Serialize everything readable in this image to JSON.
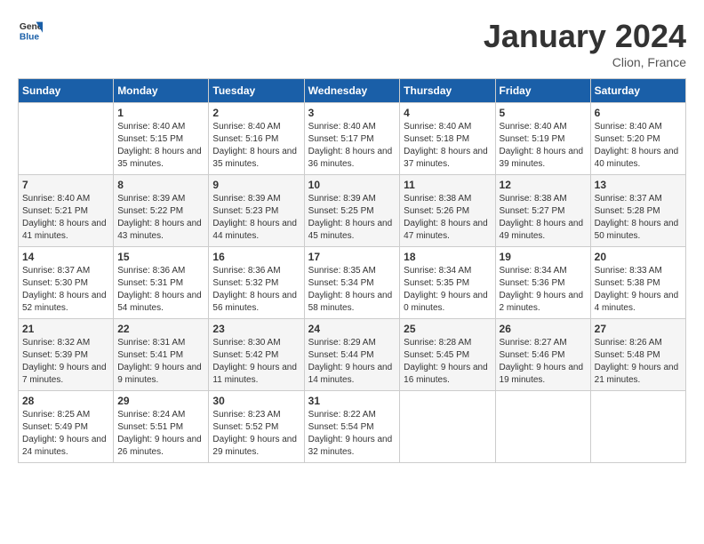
{
  "header": {
    "logo_line1": "General",
    "logo_line2": "Blue",
    "month_year": "January 2024",
    "location": "Clion, France"
  },
  "weekdays": [
    "Sunday",
    "Monday",
    "Tuesday",
    "Wednesday",
    "Thursday",
    "Friday",
    "Saturday"
  ],
  "weeks": [
    [
      {
        "day": "",
        "sunrise": "",
        "sunset": "",
        "daylight": ""
      },
      {
        "day": "1",
        "sunrise": "Sunrise: 8:40 AM",
        "sunset": "Sunset: 5:15 PM",
        "daylight": "Daylight: 8 hours and 35 minutes."
      },
      {
        "day": "2",
        "sunrise": "Sunrise: 8:40 AM",
        "sunset": "Sunset: 5:16 PM",
        "daylight": "Daylight: 8 hours and 35 minutes."
      },
      {
        "day": "3",
        "sunrise": "Sunrise: 8:40 AM",
        "sunset": "Sunset: 5:17 PM",
        "daylight": "Daylight: 8 hours and 36 minutes."
      },
      {
        "day": "4",
        "sunrise": "Sunrise: 8:40 AM",
        "sunset": "Sunset: 5:18 PM",
        "daylight": "Daylight: 8 hours and 37 minutes."
      },
      {
        "day": "5",
        "sunrise": "Sunrise: 8:40 AM",
        "sunset": "Sunset: 5:19 PM",
        "daylight": "Daylight: 8 hours and 39 minutes."
      },
      {
        "day": "6",
        "sunrise": "Sunrise: 8:40 AM",
        "sunset": "Sunset: 5:20 PM",
        "daylight": "Daylight: 8 hours and 40 minutes."
      }
    ],
    [
      {
        "day": "7",
        "sunrise": "Sunrise: 8:40 AM",
        "sunset": "Sunset: 5:21 PM",
        "daylight": "Daylight: 8 hours and 41 minutes."
      },
      {
        "day": "8",
        "sunrise": "Sunrise: 8:39 AM",
        "sunset": "Sunset: 5:22 PM",
        "daylight": "Daylight: 8 hours and 43 minutes."
      },
      {
        "day": "9",
        "sunrise": "Sunrise: 8:39 AM",
        "sunset": "Sunset: 5:23 PM",
        "daylight": "Daylight: 8 hours and 44 minutes."
      },
      {
        "day": "10",
        "sunrise": "Sunrise: 8:39 AM",
        "sunset": "Sunset: 5:25 PM",
        "daylight": "Daylight: 8 hours and 45 minutes."
      },
      {
        "day": "11",
        "sunrise": "Sunrise: 8:38 AM",
        "sunset": "Sunset: 5:26 PM",
        "daylight": "Daylight: 8 hours and 47 minutes."
      },
      {
        "day": "12",
        "sunrise": "Sunrise: 8:38 AM",
        "sunset": "Sunset: 5:27 PM",
        "daylight": "Daylight: 8 hours and 49 minutes."
      },
      {
        "day": "13",
        "sunrise": "Sunrise: 8:37 AM",
        "sunset": "Sunset: 5:28 PM",
        "daylight": "Daylight: 8 hours and 50 minutes."
      }
    ],
    [
      {
        "day": "14",
        "sunrise": "Sunrise: 8:37 AM",
        "sunset": "Sunset: 5:30 PM",
        "daylight": "Daylight: 8 hours and 52 minutes."
      },
      {
        "day": "15",
        "sunrise": "Sunrise: 8:36 AM",
        "sunset": "Sunset: 5:31 PM",
        "daylight": "Daylight: 8 hours and 54 minutes."
      },
      {
        "day": "16",
        "sunrise": "Sunrise: 8:36 AM",
        "sunset": "Sunset: 5:32 PM",
        "daylight": "Daylight: 8 hours and 56 minutes."
      },
      {
        "day": "17",
        "sunrise": "Sunrise: 8:35 AM",
        "sunset": "Sunset: 5:34 PM",
        "daylight": "Daylight: 8 hours and 58 minutes."
      },
      {
        "day": "18",
        "sunrise": "Sunrise: 8:34 AM",
        "sunset": "Sunset: 5:35 PM",
        "daylight": "Daylight: 9 hours and 0 minutes."
      },
      {
        "day": "19",
        "sunrise": "Sunrise: 8:34 AM",
        "sunset": "Sunset: 5:36 PM",
        "daylight": "Daylight: 9 hours and 2 minutes."
      },
      {
        "day": "20",
        "sunrise": "Sunrise: 8:33 AM",
        "sunset": "Sunset: 5:38 PM",
        "daylight": "Daylight: 9 hours and 4 minutes."
      }
    ],
    [
      {
        "day": "21",
        "sunrise": "Sunrise: 8:32 AM",
        "sunset": "Sunset: 5:39 PM",
        "daylight": "Daylight: 9 hours and 7 minutes."
      },
      {
        "day": "22",
        "sunrise": "Sunrise: 8:31 AM",
        "sunset": "Sunset: 5:41 PM",
        "daylight": "Daylight: 9 hours and 9 minutes."
      },
      {
        "day": "23",
        "sunrise": "Sunrise: 8:30 AM",
        "sunset": "Sunset: 5:42 PM",
        "daylight": "Daylight: 9 hours and 11 minutes."
      },
      {
        "day": "24",
        "sunrise": "Sunrise: 8:29 AM",
        "sunset": "Sunset: 5:44 PM",
        "daylight": "Daylight: 9 hours and 14 minutes."
      },
      {
        "day": "25",
        "sunrise": "Sunrise: 8:28 AM",
        "sunset": "Sunset: 5:45 PM",
        "daylight": "Daylight: 9 hours and 16 minutes."
      },
      {
        "day": "26",
        "sunrise": "Sunrise: 8:27 AM",
        "sunset": "Sunset: 5:46 PM",
        "daylight": "Daylight: 9 hours and 19 minutes."
      },
      {
        "day": "27",
        "sunrise": "Sunrise: 8:26 AM",
        "sunset": "Sunset: 5:48 PM",
        "daylight": "Daylight: 9 hours and 21 minutes."
      }
    ],
    [
      {
        "day": "28",
        "sunrise": "Sunrise: 8:25 AM",
        "sunset": "Sunset: 5:49 PM",
        "daylight": "Daylight: 9 hours and 24 minutes."
      },
      {
        "day": "29",
        "sunrise": "Sunrise: 8:24 AM",
        "sunset": "Sunset: 5:51 PM",
        "daylight": "Daylight: 9 hours and 26 minutes."
      },
      {
        "day": "30",
        "sunrise": "Sunrise: 8:23 AM",
        "sunset": "Sunset: 5:52 PM",
        "daylight": "Daylight: 9 hours and 29 minutes."
      },
      {
        "day": "31",
        "sunrise": "Sunrise: 8:22 AM",
        "sunset": "Sunset: 5:54 PM",
        "daylight": "Daylight: 9 hours and 32 minutes."
      },
      {
        "day": "",
        "sunrise": "",
        "sunset": "",
        "daylight": ""
      },
      {
        "day": "",
        "sunrise": "",
        "sunset": "",
        "daylight": ""
      },
      {
        "day": "",
        "sunrise": "",
        "sunset": "",
        "daylight": ""
      }
    ]
  ]
}
